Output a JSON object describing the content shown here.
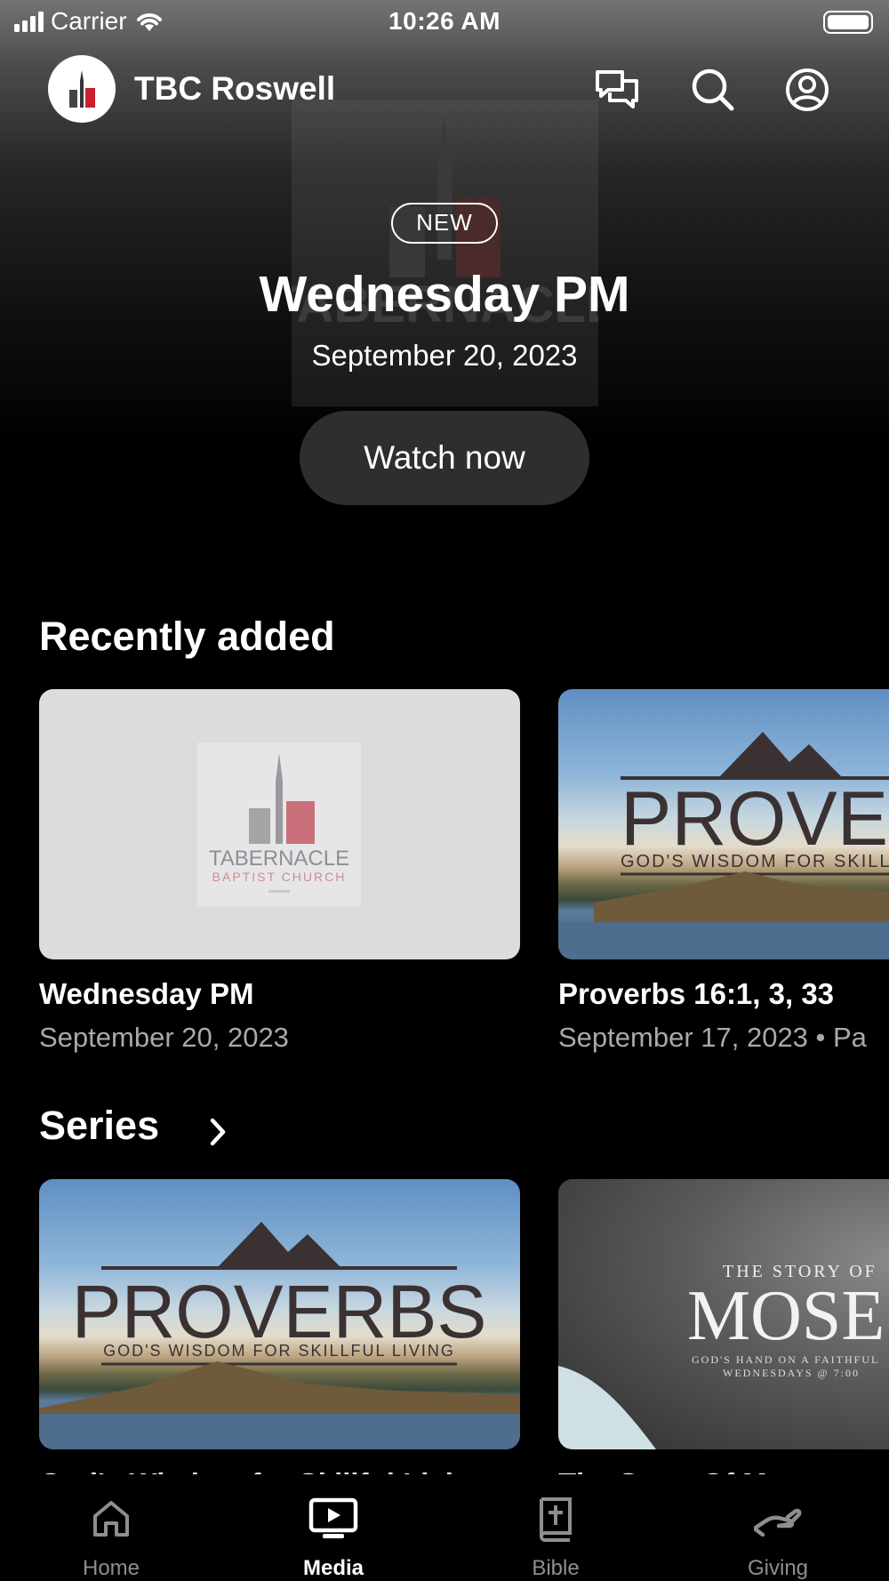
{
  "status_bar": {
    "carrier": "Carrier",
    "time": "10:26 AM"
  },
  "header": {
    "title": "TBC Roswell",
    "icons": [
      "chat-icon",
      "search-icon",
      "profile-icon"
    ]
  },
  "hero": {
    "badge": "NEW",
    "title": "Wednesday PM",
    "date": "September 20, 2023",
    "button": "Watch now",
    "watermark_text": "TABERNACLE"
  },
  "recently_added": {
    "title": "Recently added",
    "items": [
      {
        "title": "Wednesday PM",
        "subtitle": "September 20, 2023",
        "logo_line1": "TABERNACLE",
        "logo_line2": "BAPTIST CHURCH"
      },
      {
        "title": "Proverbs 16:1, 3, 33",
        "subtitle": "September 17, 2023 • Pa",
        "art_title": "PROVERBS",
        "art_subtitle": "GOD'S WISDOM FOR SKILLFUL"
      }
    ]
  },
  "series": {
    "title": "Series",
    "items": [
      {
        "art_title": "PROVERBS",
        "art_subtitle": "GOD'S WISDOM FOR SKILLFUL LIVING",
        "title": "God's Wisdom for Skillful Living"
      },
      {
        "art_kicker": "THE STORY OF",
        "art_title": "MOSES",
        "art_line1": "GOD'S HAND ON A FAITHFUL",
        "art_line2": "WEDNESDAYS @ 7:00",
        "title": "The Story Of Moses"
      }
    ]
  },
  "tab_bar": {
    "active": "Media",
    "tabs": [
      {
        "label": "Home",
        "icon": "home-icon"
      },
      {
        "label": "Media",
        "icon": "tv-icon"
      },
      {
        "label": "Bible",
        "icon": "bible-icon"
      },
      {
        "label": "Giving",
        "icon": "giving-icon"
      }
    ]
  },
  "colors": {
    "background": "#000000",
    "button_bg": "#2e2e2e",
    "secondary_text": "#a9a9a9",
    "logo_red": "#c8202f",
    "tab_inactive": "#8e8e8e"
  }
}
